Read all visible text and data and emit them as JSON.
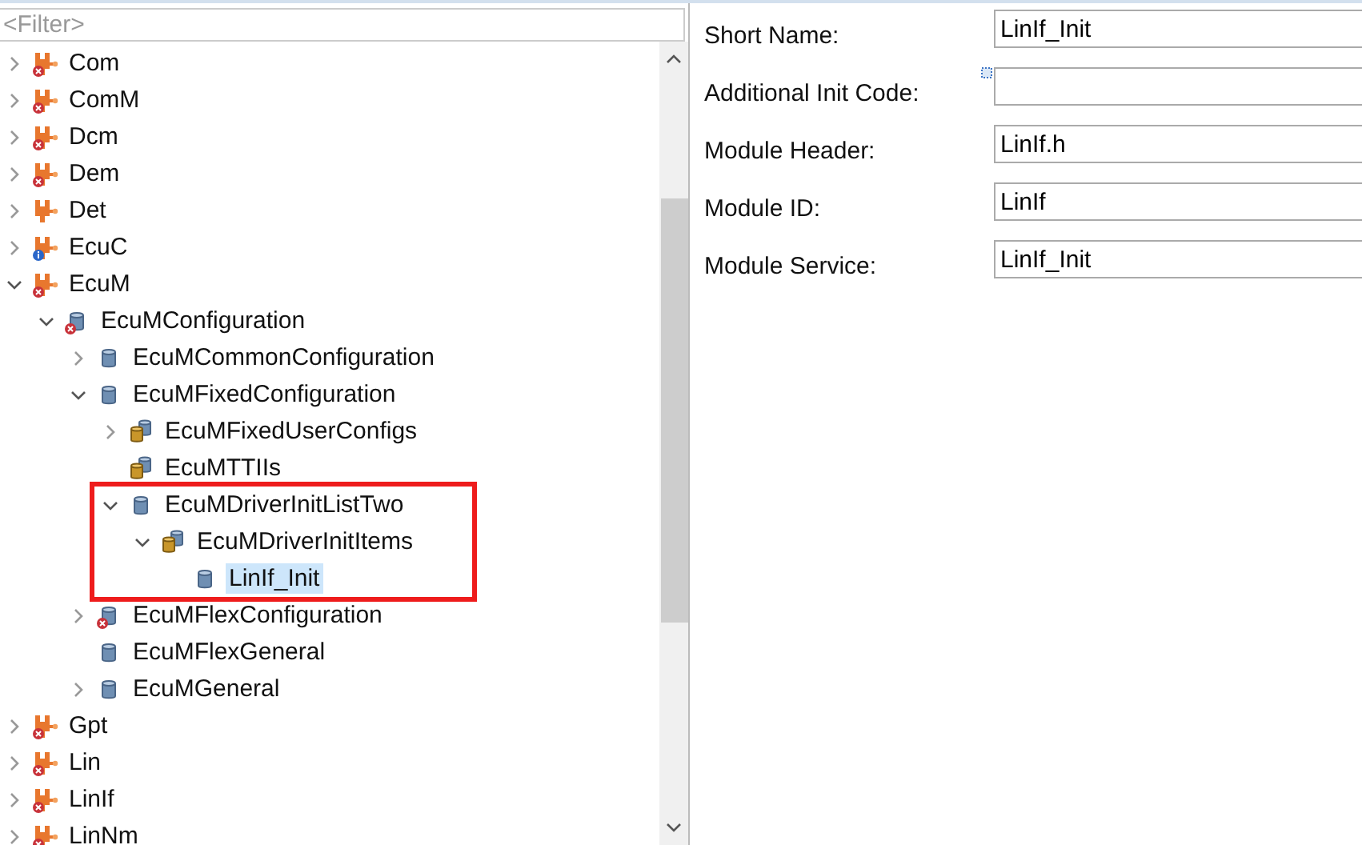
{
  "filter": {
    "placeholder": "<Filter>"
  },
  "tree": [
    {
      "label": "Com",
      "kind": "module",
      "error": true,
      "info": false,
      "expanded": false,
      "selected": false
    },
    {
      "label": "ComM",
      "kind": "module",
      "error": true,
      "info": false,
      "expanded": false,
      "selected": false
    },
    {
      "label": "Dcm",
      "kind": "module",
      "error": true,
      "info": false,
      "expanded": false,
      "selected": false
    },
    {
      "label": "Dem",
      "kind": "module",
      "error": true,
      "info": false,
      "expanded": false,
      "selected": false
    },
    {
      "label": "Det",
      "kind": "module",
      "error": false,
      "info": false,
      "expanded": false,
      "selected": false
    },
    {
      "label": "EcuC",
      "kind": "module",
      "error": false,
      "info": true,
      "expanded": false,
      "selected": false
    },
    {
      "label": "EcuM",
      "kind": "module",
      "error": true,
      "info": false,
      "expanded": true,
      "selected": false,
      "children": [
        {
          "label": "EcuMConfiguration",
          "kind": "container",
          "error": true,
          "info": false,
          "expanded": true,
          "selected": false,
          "children": [
            {
              "label": "EcuMCommonConfiguration",
              "kind": "container",
              "error": false,
              "info": false,
              "expanded": false,
              "selected": false
            },
            {
              "label": "EcuMFixedConfiguration",
              "kind": "container",
              "error": false,
              "info": false,
              "expanded": true,
              "selected": false,
              "children": [
                {
                  "label": "EcuMFixedUserConfigs",
                  "kind": "container-list",
                  "error": false,
                  "info": false,
                  "expanded": false,
                  "selected": false
                },
                {
                  "label": "EcuMTTIIs",
                  "kind": "container-list",
                  "error": false,
                  "info": false,
                  "selected": false
                },
                {
                  "label": "EcuMDriverInitListTwo",
                  "kind": "container",
                  "error": false,
                  "info": false,
                  "expanded": true,
                  "selected": false,
                  "highlighted": true,
                  "children": [
                    {
                      "label": "EcuMDriverInitItems",
                      "kind": "container-list",
                      "error": false,
                      "info": false,
                      "expanded": true,
                      "selected": false,
                      "children": [
                        {
                          "label": "LinIf_Init",
                          "kind": "container",
                          "error": false,
                          "info": false,
                          "selected": true
                        }
                      ]
                    }
                  ]
                }
              ]
            },
            {
              "label": "EcuMFlexConfiguration",
              "kind": "container",
              "error": true,
              "info": false,
              "expanded": false,
              "selected": false
            },
            {
              "label": "EcuMFlexGeneral",
              "kind": "container",
              "error": false,
              "info": false,
              "selected": false
            },
            {
              "label": "EcuMGeneral",
              "kind": "container",
              "error": false,
              "info": false,
              "expanded": false,
              "selected": false
            }
          ]
        }
      ]
    },
    {
      "label": "Gpt",
      "kind": "module",
      "error": true,
      "info": false,
      "expanded": false,
      "selected": false
    },
    {
      "label": "Lin",
      "kind": "module",
      "error": true,
      "info": false,
      "expanded": false,
      "selected": false
    },
    {
      "label": "LinIf",
      "kind": "module",
      "error": true,
      "info": false,
      "expanded": false,
      "selected": false
    },
    {
      "label": "LinNm",
      "kind": "module",
      "error": true,
      "info": false,
      "expanded": false,
      "selected": false
    }
  ],
  "properties": [
    {
      "label": "Short Name:",
      "value": "LinIf_Init",
      "hint_marker": false
    },
    {
      "label": "Additional Init Code:",
      "hint_marker": true
    },
    {
      "label": "Module Header:",
      "value": "LinIf.h",
      "hint_marker": false
    },
    {
      "label": "Module ID:",
      "value": "LinIf",
      "hint_marker": false
    },
    {
      "label": "Module Service:",
      "value": "LinIf_Init",
      "hint_marker": false
    }
  ]
}
